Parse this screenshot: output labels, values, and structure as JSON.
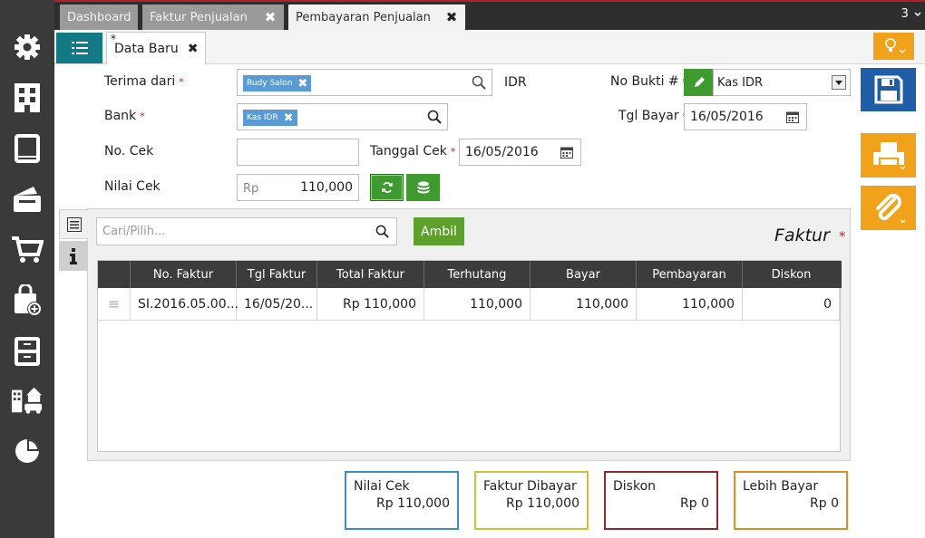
{
  "tabs": {
    "dashboard": "Dashboard",
    "faktur_penjualan": "Faktur Penjualan",
    "pembayaran_penjualan": "Pembayaran Penjualan",
    "count": "3",
    "close_glyph": "✖"
  },
  "doc_tab": {
    "star": "*",
    "label": "Data Baru",
    "close": "✖"
  },
  "form": {
    "terima_dari_label": "Terima dari",
    "terima_dari_value": "Rudy Salon",
    "bank_label": "Bank",
    "bank_value": "Kas IDR",
    "currency": "IDR",
    "no_bukti_label": "No Bukti #",
    "no_bukti_value": "Kas IDR",
    "tgl_bayar_label": "Tgl Bayar",
    "tgl_bayar_value": "16/05/2016",
    "no_cek_label": "No. Cek",
    "no_cek_value": "",
    "tanggal_cek_label": "Tanggal Cek",
    "tanggal_cek_value": "16/05/2016",
    "nilai_cek_label": "Nilai Cek",
    "nilai_cek_prefix": "Rp",
    "nilai_cek_value": "110,000",
    "required_mark": "*"
  },
  "panel": {
    "search_placeholder": "Cari/Pilih...",
    "ambil": "Ambil",
    "title": "Faktur",
    "columns": [
      "No. Faktur",
      "Tgl Faktur",
      "Total Faktur",
      "Terhutang",
      "Bayar",
      "Pembayaran",
      "Diskon"
    ],
    "row": {
      "handle": "≡",
      "no_faktur": "SI.2016.05.00...",
      "tgl_faktur": "16/05/20...",
      "total_faktur": "Rp 110,000",
      "terhutang": "110,000",
      "bayar": "110,000",
      "pembayaran": "110,000",
      "diskon": "0"
    }
  },
  "summary": [
    {
      "title": "Nilai Cek",
      "value": "Rp 110,000",
      "color": "#3b8fc4"
    },
    {
      "title": "Faktur Dibayar",
      "value": "Rp 110,000",
      "color": "#c9c43a"
    },
    {
      "title": "Diskon",
      "value": "Rp 0",
      "color": "#8e2a2a"
    },
    {
      "title": "Lebih Bayar",
      "value": "Rp 0",
      "color": "#e08a2a"
    }
  ],
  "colors": {
    "accent_teal": "#137a85",
    "save_blue": "#1f5da6",
    "action_orange": "#f0a31a",
    "green": "#3f9a2f",
    "required_red": "#d0202a"
  },
  "icons": {
    "sidebar": [
      "gear-icon",
      "building-icon",
      "book-icon",
      "wallet-icon",
      "cart-icon",
      "shopping-bag-add-icon",
      "archive-icon",
      "city-car-icon",
      "pie-chart-icon"
    ],
    "actions": [
      "save-icon",
      "print-icon",
      "paperclip-icon",
      "lightbulb-icon"
    ]
  }
}
